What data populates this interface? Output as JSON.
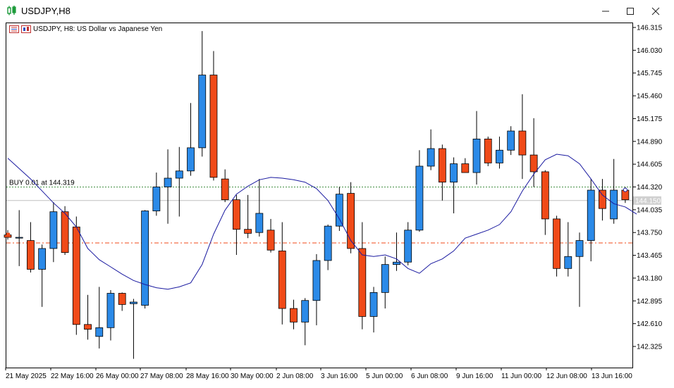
{
  "window": {
    "title": "USDJPY,H8",
    "minimize_icon": "minimize-icon",
    "maximize_icon": "maximize-icon",
    "close_icon": "close-icon"
  },
  "chart_header": {
    "symbol_line": "USDJPY, H8:  US Dollar vs Japanese Yen",
    "icons": [
      "trade-panel-icon",
      "chart-type-icon"
    ]
  },
  "colors": {
    "bull": "#2b8ae8",
    "bear": "#f04a18",
    "ma": "#1a1aa0",
    "grid_dash": "#3a8a3a",
    "stop_line": "#f04a18",
    "current_price_line": "#c0c0c0",
    "price_label_bg": "#d0d0d0"
  },
  "chart_data": {
    "type": "candlestick",
    "symbol": "USDJPY",
    "timeframe": "H8",
    "y_ticks": [
      "146.315",
      "146.030",
      "145.745",
      "145.460",
      "145.175",
      "144.890",
      "144.605",
      "144.320",
      "144.035",
      "143.750",
      "143.465",
      "143.180",
      "142.895",
      "142.610",
      "142.325"
    ],
    "x_labels": [
      "21 May 2025",
      "22 May 16:00",
      "26 May 00:00",
      "27 May 08:00",
      "28 May 16:00",
      "30 May 00:00",
      "2 Jun 08:00",
      "3 Jun 16:00",
      "5 Jun 00:00",
      "6 Jun 08:00",
      "9 Jun 16:00",
      "11 Jun 00:00",
      "12 Jun 08:00",
      "13 Jun 16:00"
    ],
    "ylim": [
      142.1,
      146.35
    ],
    "candles": [
      {
        "o": 143.72,
        "h": 143.78,
        "l": 143.66,
        "c": 143.69
      },
      {
        "o": 143.68,
        "h": 144.03,
        "l": 143.33,
        "c": 143.69
      },
      {
        "o": 143.65,
        "h": 143.88,
        "l": 143.25,
        "c": 143.29
      },
      {
        "o": 143.29,
        "h": 143.6,
        "l": 142.82,
        "c": 143.55
      },
      {
        "o": 143.55,
        "h": 144.13,
        "l": 143.38,
        "c": 144.01
      },
      {
        "o": 144.01,
        "h": 144.08,
        "l": 143.47,
        "c": 143.5
      },
      {
        "o": 143.82,
        "h": 143.95,
        "l": 142.47,
        "c": 142.6
      },
      {
        "o": 142.6,
        "h": 142.97,
        "l": 142.41,
        "c": 142.54
      },
      {
        "o": 142.45,
        "h": 143.07,
        "l": 142.3,
        "c": 142.56
      },
      {
        "o": 142.56,
        "h": 143.03,
        "l": 142.4,
        "c": 142.99
      },
      {
        "o": 142.99,
        "h": 143.0,
        "l": 142.77,
        "c": 142.85
      },
      {
        "o": 142.86,
        "h": 142.92,
        "l": 142.17,
        "c": 142.88
      },
      {
        "o": 142.84,
        "h": 144.03,
        "l": 142.8,
        "c": 144.02
      },
      {
        "o": 144.02,
        "h": 144.5,
        "l": 143.96,
        "c": 144.32
      },
      {
        "o": 144.32,
        "h": 144.79,
        "l": 143.86,
        "c": 144.43
      },
      {
        "o": 144.43,
        "h": 144.82,
        "l": 143.95,
        "c": 144.52
      },
      {
        "o": 144.52,
        "h": 145.37,
        "l": 144.46,
        "c": 144.81
      },
      {
        "o": 144.81,
        "h": 146.27,
        "l": 144.7,
        "c": 145.72
      },
      {
        "o": 145.72,
        "h": 146.02,
        "l": 144.4,
        "c": 144.44
      },
      {
        "o": 144.42,
        "h": 144.54,
        "l": 144.13,
        "c": 144.16
      },
      {
        "o": 144.16,
        "h": 144.22,
        "l": 143.47,
        "c": 143.79
      },
      {
        "o": 143.79,
        "h": 144.22,
        "l": 143.68,
        "c": 143.74
      },
      {
        "o": 143.75,
        "h": 144.42,
        "l": 143.7,
        "c": 143.99
      },
      {
        "o": 143.78,
        "h": 143.92,
        "l": 143.5,
        "c": 143.53
      },
      {
        "o": 143.52,
        "h": 143.88,
        "l": 142.6,
        "c": 142.8
      },
      {
        "o": 142.8,
        "h": 142.91,
        "l": 142.54,
        "c": 142.63
      },
      {
        "o": 142.63,
        "h": 142.93,
        "l": 142.34,
        "c": 142.9
      },
      {
        "o": 142.9,
        "h": 143.48,
        "l": 142.59,
        "c": 143.4
      },
      {
        "o": 143.4,
        "h": 143.85,
        "l": 143.28,
        "c": 143.83
      },
      {
        "o": 143.83,
        "h": 144.32,
        "l": 143.77,
        "c": 144.23
      },
      {
        "o": 144.24,
        "h": 144.38,
        "l": 143.49,
        "c": 143.55
      },
      {
        "o": 143.55,
        "h": 143.88,
        "l": 142.54,
        "c": 142.7
      },
      {
        "o": 142.7,
        "h": 143.07,
        "l": 142.5,
        "c": 143.0
      },
      {
        "o": 143.0,
        "h": 143.45,
        "l": 142.8,
        "c": 143.35
      },
      {
        "o": 143.35,
        "h": 143.75,
        "l": 143.27,
        "c": 143.38
      },
      {
        "o": 143.38,
        "h": 143.88,
        "l": 143.34,
        "c": 143.78
      },
      {
        "o": 143.78,
        "h": 144.78,
        "l": 143.76,
        "c": 144.58
      },
      {
        "o": 144.58,
        "h": 145.04,
        "l": 144.53,
        "c": 144.8
      },
      {
        "o": 144.8,
        "h": 144.85,
        "l": 144.15,
        "c": 144.38
      },
      {
        "o": 144.38,
        "h": 144.69,
        "l": 143.99,
        "c": 144.61
      },
      {
        "o": 144.61,
        "h": 144.68,
        "l": 144.5,
        "c": 144.5
      },
      {
        "o": 144.5,
        "h": 145.27,
        "l": 144.35,
        "c": 144.92
      },
      {
        "o": 144.92,
        "h": 144.95,
        "l": 144.58,
        "c": 144.62
      },
      {
        "o": 144.62,
        "h": 144.95,
        "l": 144.55,
        "c": 144.78
      },
      {
        "o": 144.78,
        "h": 145.08,
        "l": 144.72,
        "c": 145.02
      },
      {
        "o": 145.02,
        "h": 145.48,
        "l": 144.42,
        "c": 144.72
      },
      {
        "o": 144.72,
        "h": 145.18,
        "l": 144.32,
        "c": 144.51
      },
      {
        "o": 144.51,
        "h": 144.53,
        "l": 143.72,
        "c": 143.92
      },
      {
        "o": 143.92,
        "h": 143.96,
        "l": 143.2,
        "c": 143.3
      },
      {
        "o": 143.3,
        "h": 143.88,
        "l": 143.2,
        "c": 143.45
      },
      {
        "o": 143.45,
        "h": 143.75,
        "l": 142.82,
        "c": 143.65
      },
      {
        "o": 143.65,
        "h": 144.42,
        "l": 143.39,
        "c": 144.28
      },
      {
        "o": 144.28,
        "h": 144.42,
        "l": 143.9,
        "c": 144.05
      },
      {
        "o": 143.92,
        "h": 144.67,
        "l": 143.86,
        "c": 144.28
      },
      {
        "o": 144.28,
        "h": 144.32,
        "l": 144.12,
        "c": 144.16
      }
    ],
    "moving_average": [
      144.68,
      144.55,
      144.42,
      144.27,
      144.12,
      143.99,
      143.82,
      143.55,
      143.41,
      143.32,
      143.23,
      143.15,
      143.1,
      143.06,
      143.04,
      143.07,
      143.12,
      143.35,
      143.73,
      144.03,
      144.23,
      144.33,
      144.41,
      144.44,
      144.43,
      144.41,
      144.38,
      144.3,
      144.15,
      143.92,
      143.65,
      143.47,
      143.45,
      143.47,
      143.42,
      143.3,
      143.24,
      143.36,
      143.42,
      143.52,
      143.68,
      143.73,
      143.78,
      143.85,
      144.01,
      144.27,
      144.48,
      144.66,
      144.73,
      144.71,
      144.61,
      144.42,
      144.22,
      144.11,
      144.07,
      143.98
    ],
    "lines": {
      "buy_label": "BUY 0.01 at 144.319",
      "buy_price": 144.319,
      "current_price": 144.15,
      "current_price_label": "144.150",
      "stop_price": 143.62
    }
  }
}
